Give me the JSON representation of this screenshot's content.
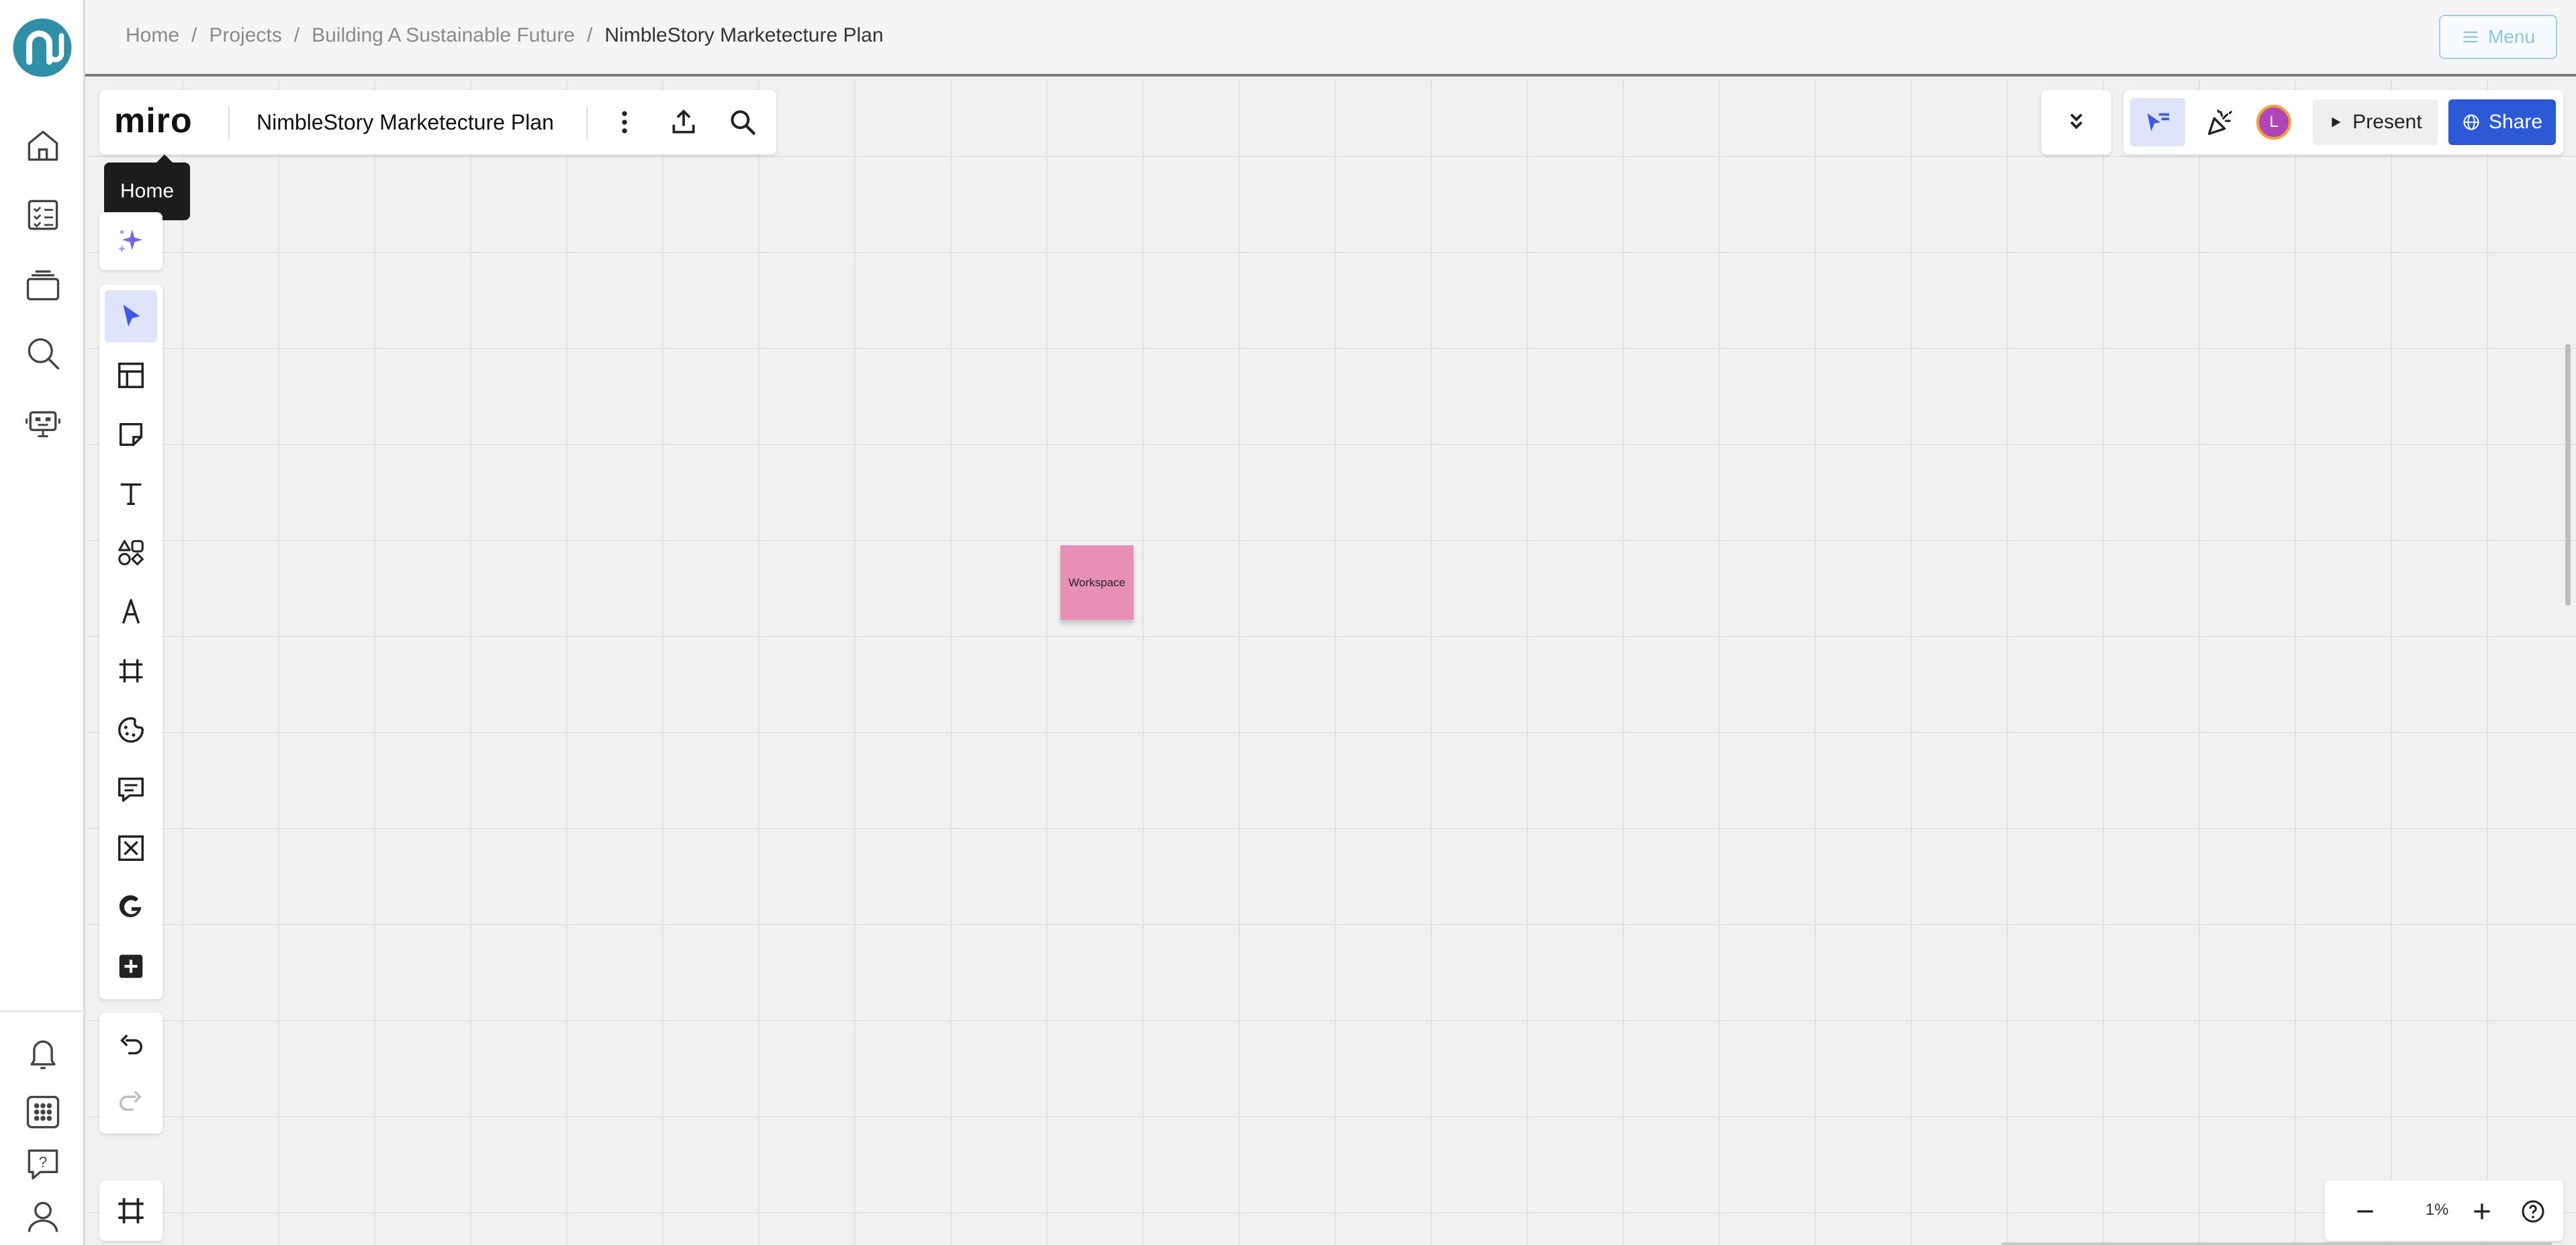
{
  "app": {
    "logo_icon": "nimblestory-logo-icon",
    "accent": "#2c5ad6",
    "rail_items": [
      {
        "name": "home",
        "icon": "home-icon"
      },
      {
        "name": "tasks",
        "icon": "checklist-icon"
      },
      {
        "name": "projects",
        "icon": "stack-icon"
      },
      {
        "name": "search",
        "icon": "search-icon"
      },
      {
        "name": "assistant",
        "icon": "robot-icon"
      }
    ],
    "rail_bottom_items": [
      {
        "name": "notifications",
        "icon": "bell-icon"
      },
      {
        "name": "apps",
        "icon": "grid-icon"
      },
      {
        "name": "help",
        "icon": "help-icon"
      },
      {
        "name": "profile",
        "icon": "user-icon"
      }
    ]
  },
  "breadcrumb": {
    "items": [
      "Home",
      "Projects",
      "Building A Sustainable Future",
      "NimbleStory Marketecture Plan"
    ],
    "separator": "/"
  },
  "menu_button": {
    "label": "Menu",
    "icon": "hamburger-icon",
    "color": "#8cc6db"
  },
  "board": {
    "logo_text": "miro",
    "title": "NimbleStory Marketecture Plan",
    "actions": [
      {
        "name": "more",
        "icon": "kebab-icon"
      },
      {
        "name": "export",
        "icon": "upload-icon"
      },
      {
        "name": "search",
        "icon": "search-icon"
      }
    ]
  },
  "tooltip": {
    "text": "Home"
  },
  "tools": [
    {
      "name": "ai-assist",
      "icon": "sparkle-icon"
    },
    {
      "name": "select",
      "icon": "cursor-icon",
      "active": true
    },
    {
      "name": "templates",
      "icon": "layout-icon"
    },
    {
      "name": "sticky-note",
      "icon": "sticky-note-icon"
    },
    {
      "name": "text",
      "icon": "text-icon"
    },
    {
      "name": "shapes",
      "icon": "shapes-icon"
    },
    {
      "name": "pen",
      "icon": "pen-icon"
    },
    {
      "name": "frame",
      "icon": "frame-icon"
    },
    {
      "name": "stickers",
      "icon": "sticker-icon"
    },
    {
      "name": "comment",
      "icon": "comment-icon"
    },
    {
      "name": "embed",
      "icon": "x-box-icon"
    },
    {
      "name": "google",
      "icon": "google-icon"
    },
    {
      "name": "more-apps",
      "icon": "plus-square-icon"
    },
    {
      "name": "undo",
      "icon": "undo-icon"
    },
    {
      "name": "redo",
      "icon": "redo-icon"
    }
  ],
  "collab": {
    "collapse_icon": "chevrons-down-icon",
    "reactions_icon": "cursor-reactions-icon",
    "celebrate_icon": "party-popper-icon",
    "avatar_initial": "L",
    "avatar_color": "#b045b6",
    "present_label": "Present",
    "present_icon": "play-icon",
    "share_label": "Share",
    "share_icon": "globe-icon"
  },
  "sticky_note": {
    "text": "Workspace",
    "color": "#e88fb6"
  },
  "frames_button": {
    "icon": "frames-icon"
  },
  "zoom": {
    "level": "1%",
    "minus_icon": "minus-icon",
    "plus_icon": "plus-icon",
    "help_icon": "help-icon"
  }
}
